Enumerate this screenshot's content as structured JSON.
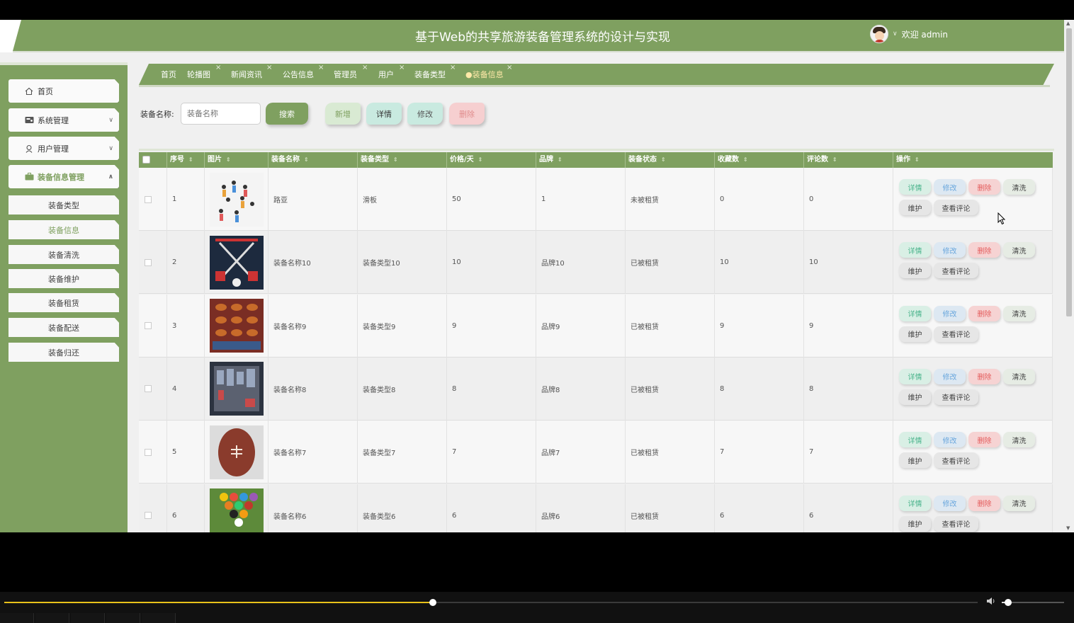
{
  "header": {
    "title": "基于Web的共享旅游装备管理系统的设计与实现",
    "welcome": "欢迎 admin"
  },
  "sidebar": {
    "items": [
      {
        "label": "首页",
        "icon": "home-icon"
      },
      {
        "label": "系统管理",
        "icon": "settings-card-icon"
      },
      {
        "label": "用户管理",
        "icon": "user-icon"
      },
      {
        "label": "装备信息管理",
        "icon": "briefcase-icon"
      }
    ],
    "sub_items": [
      "装备类型",
      "装备信息",
      "装备清洗",
      "装备维护",
      "装备租赁",
      "装备配送",
      "装备归还"
    ],
    "active_sub": "装备信息"
  },
  "tabs": [
    "首页",
    "轮播图",
    "新闻资讯",
    "公告信息",
    "管理员",
    "用户",
    "装备类型",
    "●装备信息"
  ],
  "search": {
    "label": "装备名称:",
    "placeholder": "装备名称"
  },
  "toolbar": {
    "search": "搜索",
    "add": "新增",
    "detail": "详情",
    "edit": "修改",
    "delete": "删除"
  },
  "table": {
    "headers": [
      "序号",
      "图片",
      "装备名称",
      "装备类型",
      "价格/天",
      "品牌",
      "装备状态",
      "收藏数",
      "评论数",
      "操作"
    ],
    "rows": [
      {
        "no": "1",
        "name": "路亚",
        "type": "滑板",
        "price": "50",
        "brand": "1",
        "status": "未被租赁",
        "fav": "0",
        "comments": "0"
      },
      {
        "no": "2",
        "name": "装备名称10",
        "type": "装备类型10",
        "price": "10",
        "brand": "品牌10",
        "status": "已被租赁",
        "fav": "10",
        "comments": "10"
      },
      {
        "no": "3",
        "name": "装备名称9",
        "type": "装备类型9",
        "price": "9",
        "brand": "品牌9",
        "status": "已被租赁",
        "fav": "9",
        "comments": "9"
      },
      {
        "no": "4",
        "name": "装备名称8",
        "type": "装备类型8",
        "price": "8",
        "brand": "品牌8",
        "status": "已被租赁",
        "fav": "8",
        "comments": "8"
      },
      {
        "no": "5",
        "name": "装备名称7",
        "type": "装备类型7",
        "price": "7",
        "brand": "品牌7",
        "status": "已被租赁",
        "fav": "7",
        "comments": "7"
      },
      {
        "no": "6",
        "name": "装备名称6",
        "type": "装备类型6",
        "price": "6",
        "brand": "品牌6",
        "status": "已被租赁",
        "fav": "6",
        "comments": "6"
      }
    ],
    "actions": {
      "detail": "详情",
      "edit": "修改",
      "delete": "删除",
      "clean": "清洗",
      "maintain": "维护",
      "view_reviews": "查看评论"
    }
  },
  "player": {
    "progress_fraction": 0.44,
    "volume_fraction": 0.1
  },
  "colors": {
    "primary": "#7fa060",
    "accent_text": "#ffe9a8"
  }
}
